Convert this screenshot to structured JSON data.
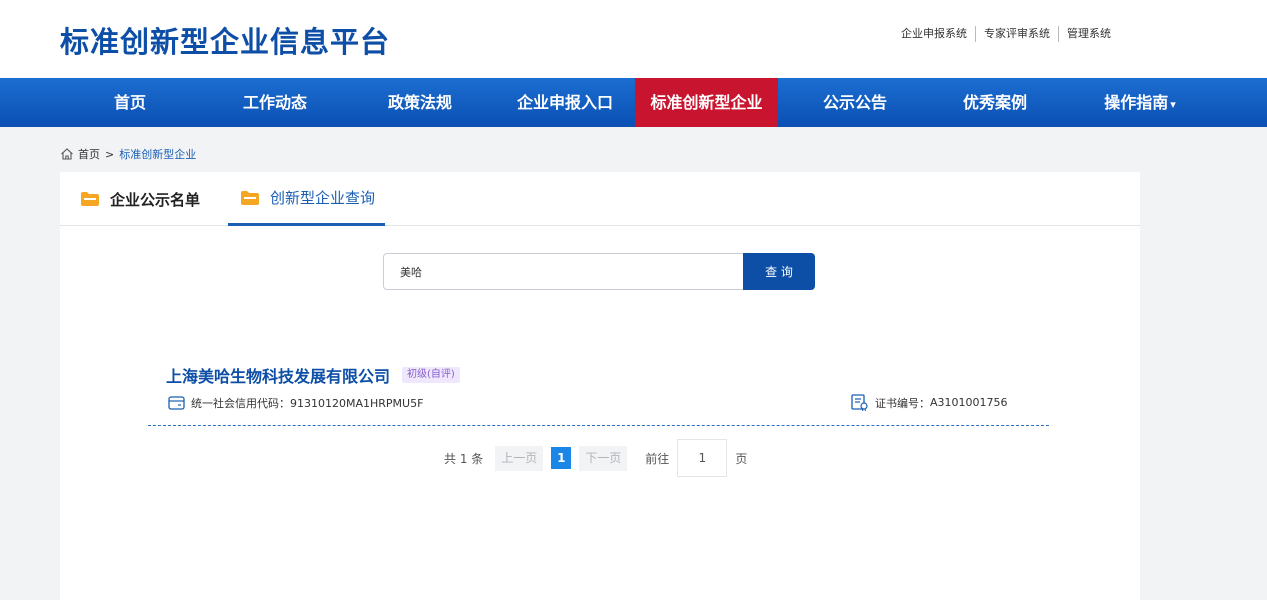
{
  "header": {
    "site_title": "标准创新型企业信息平台",
    "top_links": [
      "企业申报系统",
      "专家评审系统",
      "管理系统"
    ]
  },
  "nav": {
    "items": [
      "首页",
      "工作动态",
      "政策法规",
      "企业申报入口",
      "标准创新型企业",
      "公示公告",
      "优秀案例",
      "操作指南"
    ],
    "active_index": 4,
    "dropdown_caret": "▾"
  },
  "breadcrumb": {
    "home": "首页",
    "separator": ">",
    "current": "标准创新型企业"
  },
  "tabs": {
    "items": [
      "企业公示名单",
      "创新型企业查询"
    ],
    "active_index": 1
  },
  "search": {
    "value": "美哈",
    "button_label": "查 询"
  },
  "results": [
    {
      "company_name": "上海美哈生物科技发展有限公司",
      "level_badge": "初级(自评)",
      "credit_code_label": "统一社会信用代码：",
      "credit_code": "91310120MA1HRPMU5F",
      "cert_label": "证书编号：",
      "cert_no": "A3101001756"
    }
  ],
  "pagination": {
    "total_text": "共 1 条",
    "prev_label": "上一页",
    "current_page": "1",
    "next_label": "下一页",
    "goto_label": "前往",
    "goto_value": "1",
    "page_unit": "页"
  },
  "colors": {
    "brand_blue": "#0d4ea6",
    "nav_active_red": "#c8142e",
    "folder_orange": "#f5a623",
    "badge_purple": "#8a5fd0"
  },
  "icons": {
    "breadcrumb": "home-icon",
    "tab": "folder-icon",
    "credit": "card-icon",
    "cert": "certificate-icon"
  }
}
